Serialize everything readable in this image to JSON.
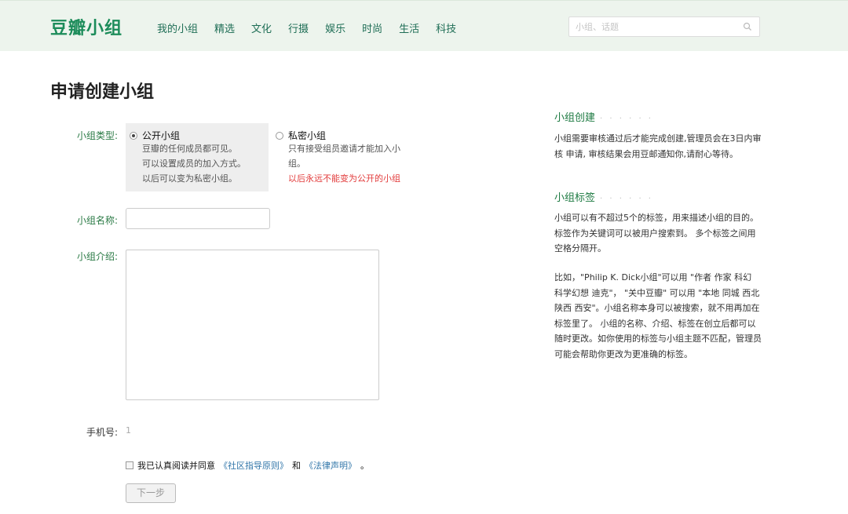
{
  "header": {
    "logo": "豆瓣小组",
    "nav": [
      "我的小组",
      "精选",
      "文化",
      "行摄",
      "娱乐",
      "时尚",
      "生活",
      "科技"
    ],
    "search_placeholder": "小组、话题"
  },
  "page": {
    "title": "申请创建小组"
  },
  "form": {
    "type_label": "小组类型:",
    "public": {
      "label": "公开小组",
      "lines": [
        "豆瓣的任何成员都可见。",
        "可以设置成员的加入方式。",
        "以后可以变为私密小组。"
      ],
      "selected": true
    },
    "private": {
      "label": "私密小组",
      "desc": "只有接受组员邀请才能加入小组。",
      "warning": "以后永远不能变为公开的小组",
      "selected": false
    },
    "name_label": "小组名称:",
    "name_value": "",
    "intro_label": "小组介绍:",
    "intro_value": "",
    "phone_label": "手机号:",
    "phone_value": "1",
    "agree_prefix": "我已认真阅读并同意",
    "agree_link1": "《社区指导原则》",
    "agree_mid": "和",
    "agree_link2": "《法律声明》",
    "agree_suffix": "。",
    "next_label": "下一步"
  },
  "sidebar": {
    "create_title": "小组创建",
    "create_text": "小组需要审核通过后才能完成创建,管理员会在3日内审核 申请, 审核结果会用豆邮通知你,请耐心等待。",
    "tags_title": "小组标签",
    "tags_text": "小组可以有不超过5个的标签，用来描述小组的目的。标签作为关键词可以被用户搜索到。 多个标签之间用空格分隔开。",
    "tags_example": "比如，\"Philip K. Dick小组\"可以用 \"作者 作家 科幻 科学幻想 迪克\"， \"关中豆瓣\" 可以用 \"本地 同城 西北 陕西 西安\"。小组名称本身可以被搜索，就不用再加在标签里了。 小组的名称、介绍、标签在创立后都可以随时更改。如你使用的标签与小组主题不匹配，管理员可能会帮助你更改为更准确的标签。",
    "dots": "· · · · · ·"
  },
  "colors": {
    "brand": "#1c8c5a",
    "link": "#3377aa",
    "warning": "#e23b3b",
    "topbar_bg": "#edf4ed"
  }
}
